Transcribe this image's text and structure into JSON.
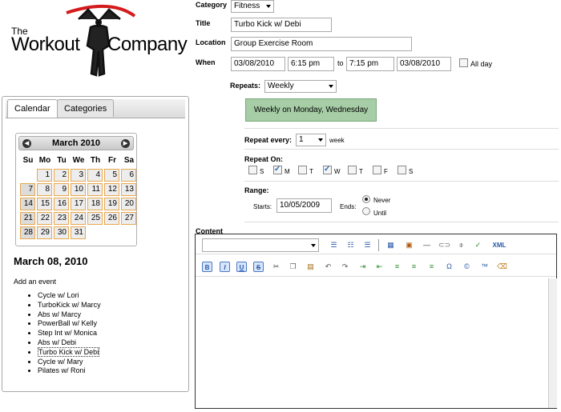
{
  "logo": {
    "line1": "The",
    "line2": "Workout",
    "line3": "Company"
  },
  "tabs": [
    {
      "label": "Calendar"
    },
    {
      "label": "Categories"
    }
  ],
  "calendar": {
    "month": "March 2010",
    "prev": "◀",
    "next": "▶",
    "dow": [
      "Su",
      "Mo",
      "Tu",
      "We",
      "Th",
      "Fr",
      "Sa"
    ],
    "weeks": [
      [
        "",
        "1",
        "2",
        "3",
        "4",
        "5",
        "6"
      ],
      [
        "7",
        "8",
        "9",
        "10",
        "11",
        "12",
        "13"
      ],
      [
        "14",
        "15",
        "16",
        "17",
        "18",
        "19",
        "20"
      ],
      [
        "21",
        "22",
        "23",
        "24",
        "25",
        "26",
        "27"
      ],
      [
        "28",
        "29",
        "30",
        "31",
        "",
        "",
        ""
      ]
    ]
  },
  "selected_date": "March 08, 2010",
  "add_event": "Add an event",
  "events": [
    "Cycle w/ Lori",
    "TurboKick w/ Marcy",
    "Abs w/ Marcy",
    "PowerBall w/ Kelly",
    "Step Int w/ Monica",
    "Abs w/ Debi",
    "Turbo Kick w/ Debi",
    "Cycle w/ Mary",
    "Pilates w/ Roni"
  ],
  "form": {
    "category_label": "Category",
    "category_value": "Fitness",
    "title_label": "Title",
    "title_value": "Turbo Kick w/ Debi",
    "location_label": "Location",
    "location_value": "Group Exercise Room",
    "when_label": "When",
    "start_date": "03/08/2010",
    "start_time": "6:15 pm",
    "to": "to",
    "end_time": "7:15 pm",
    "end_date": "03/08/2010",
    "allday": "All day",
    "repeats_label": "Repeats:",
    "repeats_value": "Weekly",
    "summary": "Weekly on Monday, Wednesday",
    "every_label": "Repeat every:",
    "every_value": "1",
    "every_unit": "week",
    "on_label": "Repeat On:",
    "days": [
      {
        "l": "S",
        "on": false
      },
      {
        "l": "M",
        "on": true
      },
      {
        "l": "T",
        "on": false
      },
      {
        "l": "W",
        "on": true
      },
      {
        "l": "T",
        "on": false
      },
      {
        "l": "F",
        "on": false
      },
      {
        "l": "S",
        "on": false
      }
    ],
    "range_label": "Range:",
    "starts_label": "Starts:",
    "starts_value": "10/05/2009",
    "ends_label": "Ends:",
    "never": "Never",
    "until": "Until",
    "content_label": "Content"
  },
  "toolbar": {
    "xml": "XML",
    "bold": "B",
    "italic": "I",
    "underline": "U",
    "strike": "S"
  }
}
